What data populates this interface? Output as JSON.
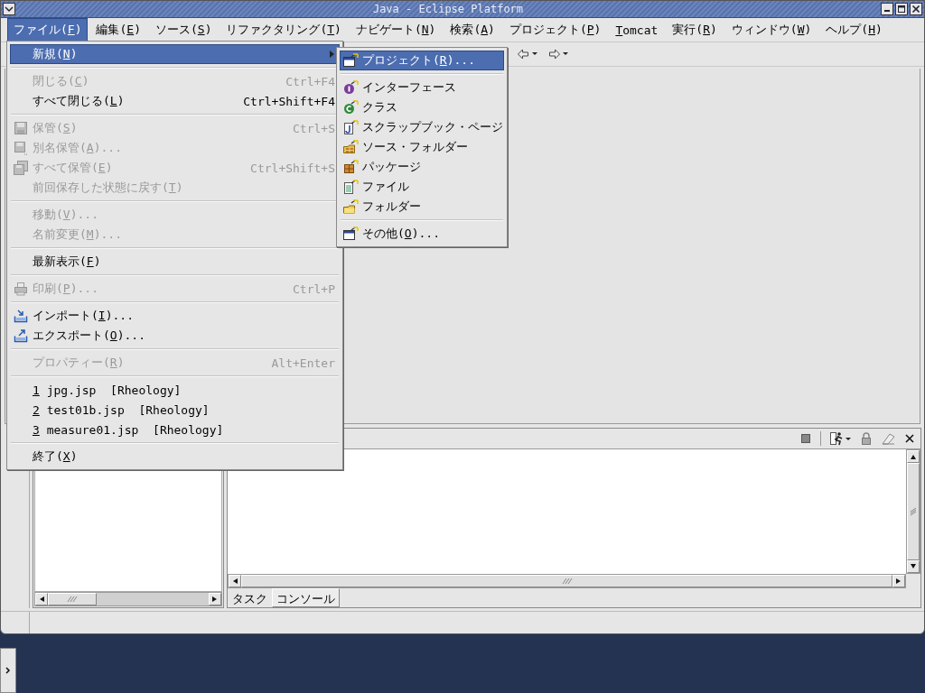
{
  "window": {
    "title": "Java - Eclipse Platform"
  },
  "menubar": [
    {
      "label": "ファイル(",
      "mnemonic": "F",
      "after": ")",
      "selected": true
    },
    {
      "label": "編集(",
      "mnemonic": "E",
      "after": ")",
      "selected": false
    },
    {
      "label": "ソース(",
      "mnemonic": "S",
      "after": ")",
      "selected": false
    },
    {
      "label": "リファクタリング(",
      "mnemonic": "T",
      "after": ")",
      "selected": false
    },
    {
      "label": "ナビゲート(",
      "mnemonic": "N",
      "after": ")",
      "selected": false
    },
    {
      "label": "検索(",
      "mnemonic": "A",
      "after": ")",
      "selected": false
    },
    {
      "label": "プロジェクト(",
      "mnemonic": "P",
      "after": ")",
      "selected": false
    },
    {
      "mnemonic": "T",
      "after": "omcat",
      "selected": false
    },
    {
      "label": "実行(",
      "mnemonic": "R",
      "after": ")",
      "selected": false
    },
    {
      "label": "ウィンドウ(",
      "mnemonic": "W",
      "after": ")",
      "selected": false
    },
    {
      "label": "ヘルプ(",
      "mnemonic": "H",
      "after": ")",
      "selected": false
    }
  ],
  "file_menu": [
    {
      "kind": "item",
      "label": "新規(",
      "mnemonic": "N",
      "after": ")",
      "selected": true,
      "disabled": false,
      "submenu": true
    },
    {
      "kind": "separator"
    },
    {
      "kind": "item",
      "label": "閉じる(",
      "mnemonic": "C",
      "after": ")",
      "shortcut": "Ctrl+F4",
      "selected": false,
      "disabled": true,
      "submenu": false
    },
    {
      "kind": "item",
      "label": "すべて閉じる(",
      "mnemonic": "L",
      "after": ")",
      "shortcut": "Ctrl+Shift+F4",
      "selected": false,
      "disabled": false,
      "submenu": false
    },
    {
      "kind": "separator"
    },
    {
      "kind": "item",
      "label": "保管(",
      "mnemonic": "S",
      "after": ")",
      "shortcut": "Ctrl+S",
      "selected": false,
      "disabled": true,
      "submenu": false
    },
    {
      "kind": "item",
      "label": "別名保管(",
      "mnemonic": "A",
      "after": ")...",
      "selected": false,
      "disabled": true,
      "submenu": false
    },
    {
      "kind": "item",
      "label": "すべて保管(",
      "mnemonic": "E",
      "after": ")",
      "shortcut": "Ctrl+Shift+S",
      "selected": false,
      "disabled": true,
      "submenu": false
    },
    {
      "kind": "item",
      "label": "前回保存した状態に戻す(",
      "mnemonic": "T",
      "after": ")",
      "selected": false,
      "disabled": true,
      "submenu": false
    },
    {
      "kind": "separator"
    },
    {
      "kind": "item",
      "label": "移動(",
      "mnemonic": "V",
      "after": ")...",
      "selected": false,
      "disabled": true,
      "submenu": false
    },
    {
      "kind": "item",
      "label": "名前変更(",
      "mnemonic": "M",
      "after": ")...",
      "selected": false,
      "disabled": true,
      "submenu": false
    },
    {
      "kind": "separator"
    },
    {
      "kind": "item",
      "label": "最新表示(",
      "mnemonic": "F",
      "after": ")",
      "selected": false,
      "disabled": false,
      "submenu": false
    },
    {
      "kind": "separator"
    },
    {
      "kind": "item",
      "label": "印刷(",
      "mnemonic": "P",
      "after": ")...",
      "shortcut": "Ctrl+P",
      "selected": false,
      "disabled": true,
      "submenu": false
    },
    {
      "kind": "separator"
    },
    {
      "kind": "item",
      "label": "インポート(",
      "mnemonic": "I",
      "after": ")...",
      "selected": false,
      "disabled": false,
      "submenu": false
    },
    {
      "kind": "item",
      "label": "エクスポート(",
      "mnemonic": "O",
      "after": ")...",
      "selected": false,
      "disabled": false,
      "submenu": false
    },
    {
      "kind": "separator"
    },
    {
      "kind": "item",
      "label": "プロパティー(",
      "mnemonic": "R",
      "after": ")",
      "shortcut": "Alt+Enter",
      "selected": false,
      "disabled": true,
      "submenu": false
    },
    {
      "kind": "separator"
    },
    {
      "kind": "item",
      "mnemonic": "1",
      "after": " jpg.jsp  [Rheology]",
      "selected": false,
      "disabled": false,
      "submenu": false
    },
    {
      "kind": "item",
      "mnemonic": "2",
      "after": " test01b.jsp  [Rheology]",
      "selected": false,
      "disabled": false,
      "submenu": false
    },
    {
      "kind": "item",
      "mnemonic": "3",
      "after": " measure01.jsp  [Rheology]",
      "selected": false,
      "disabled": false,
      "submenu": false
    },
    {
      "kind": "separator"
    },
    {
      "kind": "item",
      "label": "終了(",
      "mnemonic": "X",
      "after": ")",
      "selected": false,
      "disabled": false,
      "submenu": false
    }
  ],
  "new_submenu": [
    {
      "kind": "item",
      "label": "プロジェクト(",
      "mnemonic": "R",
      "after": ")...",
      "selected": true,
      "disabled": false,
      "submenu": false
    },
    {
      "kind": "separator"
    },
    {
      "kind": "item",
      "label": "インターフェース",
      "selected": false,
      "disabled": false,
      "submenu": false
    },
    {
      "kind": "item",
      "label": "クラス",
      "selected": false,
      "disabled": false,
      "submenu": false
    },
    {
      "kind": "item",
      "label": "スクラップブック・ページ",
      "selected": false,
      "disabled": false,
      "submenu": false
    },
    {
      "kind": "item",
      "label": "ソース・フォルダー",
      "selected": false,
      "disabled": false,
      "submenu": false
    },
    {
      "kind": "item",
      "label": "パッケージ",
      "selected": false,
      "disabled": false,
      "submenu": false
    },
    {
      "kind": "item",
      "label": "ファイル",
      "selected": false,
      "disabled": false,
      "submenu": false
    },
    {
      "kind": "item",
      "label": "フォルダー",
      "selected": false,
      "disabled": false,
      "submenu": false
    },
    {
      "kind": "separator"
    },
    {
      "kind": "item",
      "label": "その他(",
      "mnemonic": "O",
      "after": ")...",
      "selected": false,
      "disabled": false,
      "submenu": false
    }
  ],
  "console_view": {
    "tabs": [
      {
        "label": "タスク",
        "selected": false
      },
      {
        "label": "コンソール",
        "selected": true
      }
    ]
  }
}
